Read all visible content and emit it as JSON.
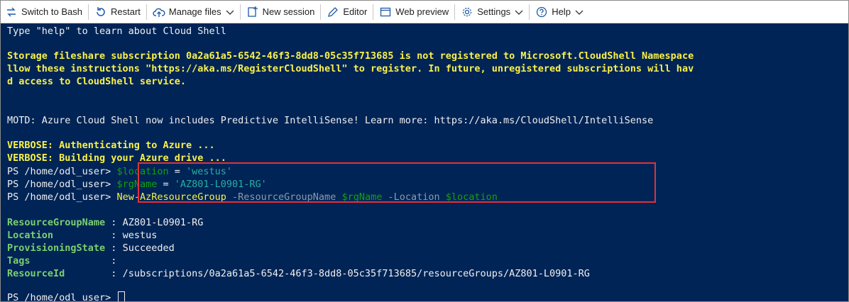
{
  "toolbar": {
    "switch_label": "Switch to Bash",
    "restart_label": "Restart",
    "manage_files_label": "Manage files",
    "new_session_label": "New session",
    "editor_label": "Editor",
    "web_preview_label": "Web preview",
    "settings_label": "Settings",
    "help_label": "Help"
  },
  "terminal": {
    "help_line": "Type \"help\" to learn about Cloud Shell",
    "storage_line1": "Storage fileshare subscription 0a2a61a5-6542-46f3-8dd8-05c35f713685 is not registered to Microsoft.CloudShell Namespace",
    "storage_line2": "llow these instructions \"https://aka.ms/RegisterCloudShell\" to register. In future, unregistered subscriptions will hav",
    "storage_line3": "d access to CloudShell service.",
    "motd_line": "MOTD: Azure Cloud Shell now includes Predictive IntelliSense! Learn more: https://aka.ms/CloudShell/IntelliSense",
    "verbose_line1": "VERBOSE: Authenticating to Azure ...",
    "verbose_line2": "VERBOSE: Building your Azure drive ...",
    "prompt": "PS /home/odl_user>",
    "cmd1_var": "$location",
    "cmd1_op": " = ",
    "cmd1_val": "'westus'",
    "cmd2_var": "$rgName",
    "cmd2_op": " = ",
    "cmd2_val": "'AZ801-L0901-RG'",
    "cmd3_cmdlet": "New-AzResourceGroup",
    "cmd3_p1": " -ResourceGroupName ",
    "cmd3_v1": "$rgName",
    "cmd3_p2": " -Location ",
    "cmd3_v2": "$location",
    "output": [
      {
        "key": "ResourceGroupName",
        "pad": " : ",
        "value": "AZ801-L0901-RG"
      },
      {
        "key": "Location         ",
        "pad": " : ",
        "value": "westus"
      },
      {
        "key": "ProvisioningState",
        "pad": " : ",
        "value": "Succeeded"
      },
      {
        "key": "Tags             ",
        "pad": " :",
        "value": ""
      },
      {
        "key": "ResourceId       ",
        "pad": " : ",
        "value": "/subscriptions/0a2a61a5-6542-46f3-8dd8-05c35f713685/resourceGroups/AZ801-L0901-RG"
      }
    ],
    "final_prompt": "PS /home/odl_user> "
  },
  "colors": {
    "terminal_bg": "#012456",
    "warning_yellow": "#f9f148",
    "highlight_red": "#e0323a",
    "key_green": "#7ad06e"
  }
}
